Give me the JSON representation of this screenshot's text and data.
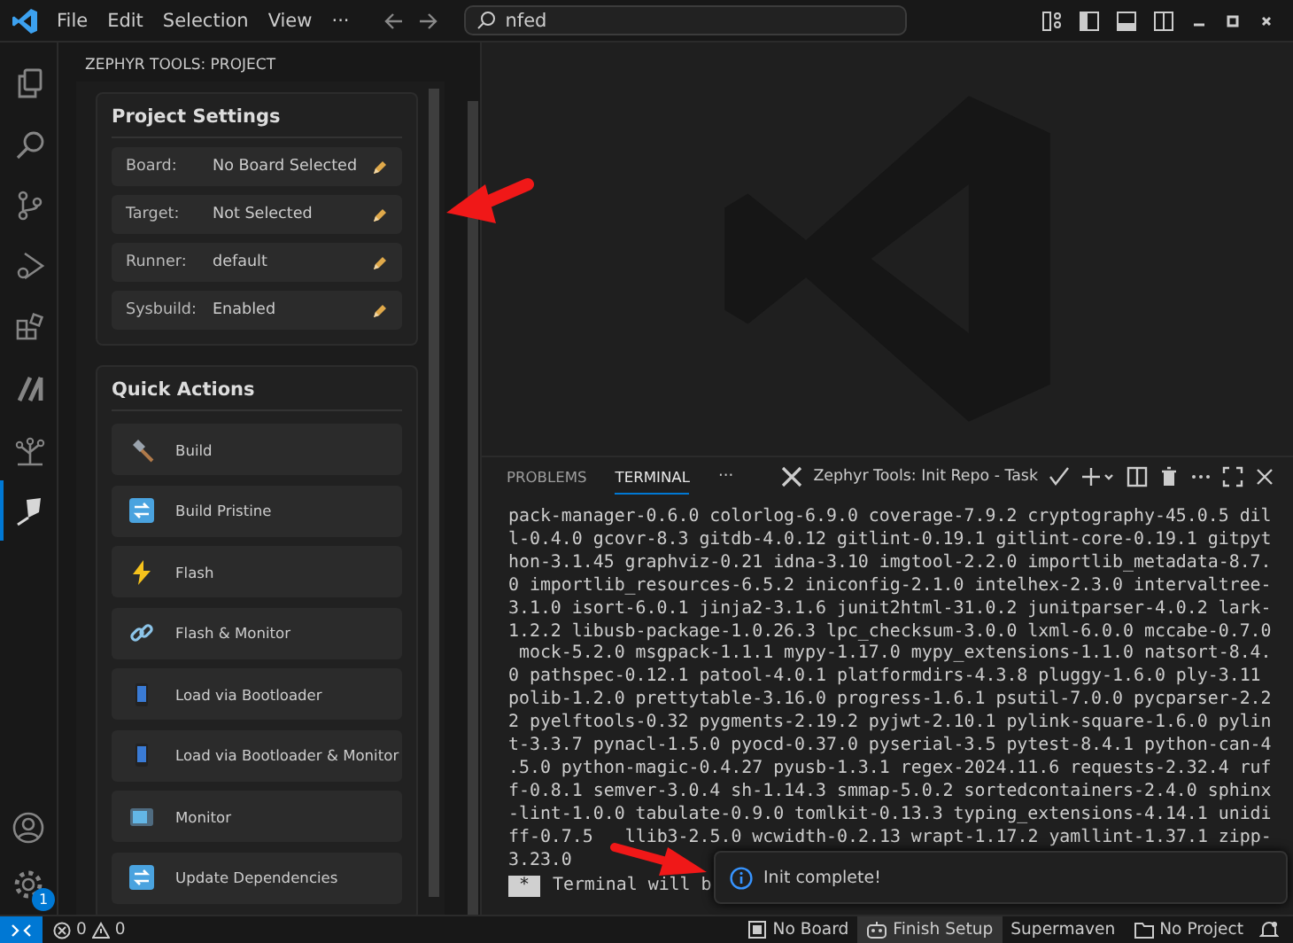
{
  "menu": [
    "File",
    "Edit",
    "Selection",
    "View",
    "···"
  ],
  "search": {
    "value": "nfed"
  },
  "activity_bar": {
    "items": [
      {
        "kind": "files",
        "selected": false
      },
      {
        "kind": "search",
        "selected": false
      },
      {
        "kind": "branch",
        "selected": false
      },
      {
        "kind": "debug",
        "selected": false
      },
      {
        "kind": "extensions",
        "selected": false
      },
      {
        "kind": "slash",
        "selected": false
      },
      {
        "kind": "tree",
        "selected": false
      },
      {
        "kind": "kite",
        "selected": true
      }
    ],
    "settings_badge": "1"
  },
  "sidebar": {
    "title": "ZEPHYR TOOLS: PROJECT",
    "settings": {
      "title": "Project Settings",
      "rows": [
        {
          "label": "Board:",
          "value": "No Board Selected"
        },
        {
          "label": "Target:",
          "value": "Not Selected"
        },
        {
          "label": "Runner:",
          "value": "default"
        },
        {
          "label": "Sysbuild:",
          "value": "Enabled"
        }
      ]
    },
    "quick_actions": {
      "title": "Quick Actions",
      "items": [
        {
          "label": "Build",
          "kind": "hammer"
        },
        {
          "label": "Build Pristine",
          "kind": "refresh"
        },
        {
          "label": "Flash",
          "kind": "bolt"
        },
        {
          "label": "Flash & Monitor",
          "kind": "link"
        },
        {
          "label": "Load via Bootloader",
          "kind": "phone"
        },
        {
          "label": "Load via Bootloader & Monitor",
          "kind": "phone"
        },
        {
          "label": "Monitor",
          "kind": "tv"
        },
        {
          "label": "Update Dependencies",
          "kind": "refresh"
        }
      ]
    }
  },
  "panel": {
    "tabs": [
      {
        "label": "PROBLEMS",
        "selected": false
      },
      {
        "label": "TERMINAL",
        "selected": true
      }
    ],
    "more": "···",
    "task": "Zephyr Tools: Init Repo - Task",
    "lines": [
      "pack-manager-0.6.0 colorlog-6.9.0 coverage-7.9.2 cryptography-45.0.5 dil",
      "l-0.4.0 gcovr-8.3 gitdb-4.0.12 gitlint-0.19.1 gitlint-core-0.19.1 gitpyt",
      "hon-3.1.45 graphviz-0.21 idna-3.10 imgtool-2.2.0 importlib_metadata-8.7.",
      "0 importlib_resources-6.5.2 iniconfig-2.1.0 intelhex-2.3.0 intervaltree-",
      "3.1.0 isort-6.0.1 jinja2-3.1.6 junit2html-31.0.2 junitparser-4.0.2 lark-",
      "1.2.2 libusb-package-1.0.26.3 lpc_checksum-3.0.0 lxml-6.0.0 mccabe-0.7.0",
      " mock-5.2.0 msgpack-1.1.1 mypy-1.17.0 mypy_extensions-1.1.0 natsort-8.4.",
      "0 pathspec-0.12.1 patool-4.0.1 platformdirs-4.3.8 pluggy-1.6.0 ply-3.11",
      "polib-1.2.0 prettytable-3.16.0 progress-1.6.1 psutil-7.0.0 pycparser-2.2",
      "2 pyelftools-0.32 pygments-2.19.2 pyjwt-2.10.1 pylink-square-1.6.0 pylin",
      "t-3.3.7 pynacl-1.5.0 pyocd-0.37.0 pyserial-3.5 pytest-8.4.1 python-can-4",
      ".5.0 python-magic-0.4.27 pyusb-1.3.1 regex-2024.11.6 requests-2.32.4 ruf",
      "f-0.8.1 semver-3.0.4 sh-1.14.3 smmap-5.0.2 sortedcontainers-2.4.0 sphinx",
      "-lint-1.0.0 tabulate-0.9.0 tomlkit-0.13.3 typing_extensions-4.14.1 unidi"
    ],
    "occluded_line": [
      "ff-0.7.5",
      "llib3-2.5.0 wcwidth-0.2.13 wrapt-1.17.2 yamllint-1.37.1 zipp-"
    ],
    "lines_after": [
      "3.23.0"
    ],
    "cursor": "*",
    "last_line": "Terminal will b"
  },
  "toast": {
    "message": "Init complete!"
  },
  "status_bar": {
    "errors": "0",
    "warnings": "0",
    "items": [
      {
        "label": "No Board",
        "kind": "board",
        "highlighted": false
      },
      {
        "label": "Finish Setup",
        "kind": "bot",
        "highlighted": true
      },
      {
        "label": "Supermaven",
        "kind": "none",
        "highlighted": false
      },
      {
        "label": "No Project",
        "kind": "folder",
        "highlighted": false
      }
    ]
  }
}
